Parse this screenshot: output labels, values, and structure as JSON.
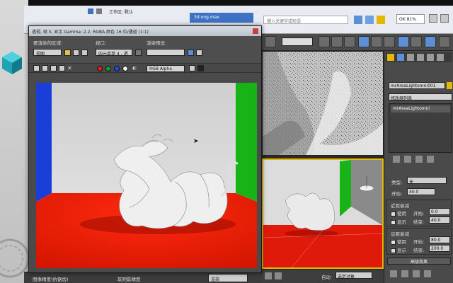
{
  "window_title_row": {
    "tab_text": "3d ong.max",
    "search_placeholder": "键入关键字或短语"
  },
  "render_window": {
    "title": "透视, 帧 0, 显示 Gamma: 2.2, RGBA 颜色 16 位/通道 (1:1)",
    "region_label": "要渲染的区域:",
    "region_value": "视图",
    "viewport_label": "视口:",
    "viewport_value": "四元菜单 4 - 透",
    "preset_label": "渲染预设:",
    "preset_value": "",
    "channel_value": "RGB Alpha",
    "channel_colors": [
      "#e02020",
      "#20a020",
      "#2050e0",
      "#f0f0f0"
    ]
  },
  "command_panel": {
    "object_name": "mrAreaLightomni001",
    "modifier_list": "修改器列表",
    "stack_item": "mrAreaLightomni",
    "shadow_type_label": "类型:",
    "shadow_type_value": "无",
    "start_label": "开始:",
    "start_value": "40.0",
    "near_atten_label": "近距衰减",
    "use_label": "使用",
    "show_label": "显示",
    "begin_label": "开始:",
    "begin_value": "0.0",
    "end_label": "结束:",
    "end_value": "40.0",
    "far_atten_label": "远距衰减",
    "far_begin_value": "80.0",
    "far_end_value": "200.0",
    "advanced_label": "高级效果"
  },
  "status_bar": {
    "auto_label": "自动",
    "select_label": "选定对象",
    "frame_label": "0"
  },
  "bottom_strip": {
    "left_text": "图像精度(抗锯齿)",
    "mid_text": "软阴影精度",
    "right_text": "渲染"
  },
  "colors": {
    "floor_red": "#e01a0a",
    "wall_green": "#17b317",
    "wall_blue": "#1a3fd9",
    "accent_yellow": "#e2b800"
  }
}
